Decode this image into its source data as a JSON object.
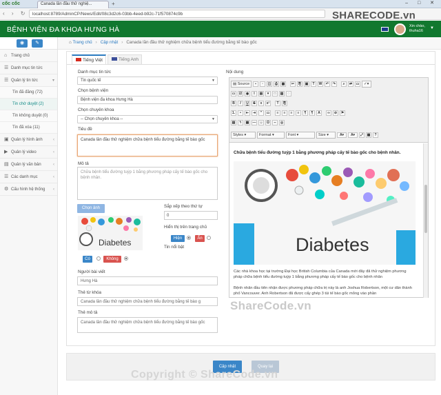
{
  "browser": {
    "app_name": "cốc cốc",
    "tab_title": "Canada lần đầu thử nghiệ...",
    "url": "localhost:8789/AdminCP/News/Edit/08c3d2c6-03bb-4eed-b92c-71f570874c9b"
  },
  "header": {
    "title": "BỆNH VIỆN ĐA KHOA HƯNG HÀ",
    "greeting": "Xin chào,",
    "username": "thuha16"
  },
  "watermark": {
    "brand_top": "SHARECODE",
    "brand_top_suffix": ".vn",
    "mid": "ShareCode.vn",
    "bottom": "Copyright © ShareCode.vn"
  },
  "sidebar": {
    "items": [
      {
        "label": "Trang chủ",
        "icon": "⌂"
      },
      {
        "label": "Danh mục tin tức",
        "icon": "☰"
      },
      {
        "label": "Quản lý tin tức",
        "icon": "☰"
      }
    ],
    "subitems": [
      {
        "label": "Tin đã đăng (72)"
      },
      {
        "label": "Tin chờ duyệt (2)"
      },
      {
        "label": "Tin không duyệt (0)"
      },
      {
        "label": "Tin đã xóa (11)"
      }
    ],
    "items2": [
      {
        "label": "Quản lý hình ảnh",
        "icon": "▣"
      },
      {
        "label": "Quản lý video",
        "icon": "▶"
      },
      {
        "label": "Quản lý văn bản",
        "icon": "▤"
      },
      {
        "label": "Các danh mục",
        "icon": "☰"
      },
      {
        "label": "Cấu hình hệ thống",
        "icon": "⚙"
      }
    ]
  },
  "breadcrumb": {
    "home": "Trang chủ",
    "update": "Cập nhật",
    "current": "Canada lần đầu thử nghiệm chữa bệnh tiểu đường bằng tế bào gốc"
  },
  "tabs": {
    "vi": "Tiếng Việt",
    "en": "Tiếng Anh"
  },
  "form": {
    "category_label": "Danh mục tin tức",
    "category_value": "Tin quốc tế",
    "hospital_label": "Chọn bệnh viện",
    "hospital_value": "Bệnh viện đa khoa Hưng Hà",
    "specialty_label": "Chọn chuyên khoa",
    "specialty_value": "-- Chọn chuyên khoa --",
    "title_label": "Tiêu đề",
    "title_value": "Canada lần đầu thử nghiệm chữa bệnh tiểu đường bằng tế bào gốc",
    "desc_label": "Mô tả",
    "desc_value": "Chữa bệnh tiểu đường tuýp 1 bằng phương pháp cấy tế bào gốc cho bệnh nhân.",
    "image_button": "Chọn ảnh",
    "image_caption": "Diabetes",
    "yes_label": "Có",
    "no_label": "Không",
    "order_label": "Sắp xếp theo thứ tự",
    "order_value": "0",
    "show_home_label": "Hiển thị trên trang chủ",
    "show_label": "Hiện",
    "hide_label": "Ẩn",
    "featured_label": "Tin nổi bật",
    "author_label": "Người bài viết",
    "author_value": "Hưng Hà",
    "meta_keyword_label": "Thẻ từ khóa",
    "meta_keyword_value": "Canada lần đầu thử nghiệm chữa bệnh tiểu đường bằng tế bào g",
    "meta_desc_label": "Thẻ mô tả",
    "meta_desc_value": "Canada lần đầu thử nghiệm chữa bệnh tiểu đường bằng tế bào gốc"
  },
  "editor": {
    "label": "Nội dung",
    "source_label": "Source",
    "styles_label": "Styles",
    "format_label": "Format",
    "font_label": "Font",
    "size_label": "Size",
    "heading": "Chữa bệnh tiểu đường tuýp 1 bằng phương pháp cấy tế bào gốc cho bệnh nhân.",
    "image_text": "Diabetes",
    "para1": "Các nhà khoa học tại trường Đại học British Columbia của Canada mới đây đã thử nghiệm phương pháp chữa bệnh tiểu đường tuýp 1 bằng phương pháp cấy tế bào gốc cho bệnh nhân",
    "para2": "Bệnh nhân đầu tiên nhận được phương pháp chữa trị này là anh Joshua Robertson, một cư dân thành phố Vancouver. Anh Robertson đã được cấy ghép 3 túi tế bào gốc mỏng vào phần"
  },
  "actions": {
    "update": "Cập nhật",
    "back": "Quay lại"
  },
  "colors": {
    "header_green": "#11782f",
    "primary_blue": "#3a86c8",
    "danger_red": "#d9534f"
  }
}
